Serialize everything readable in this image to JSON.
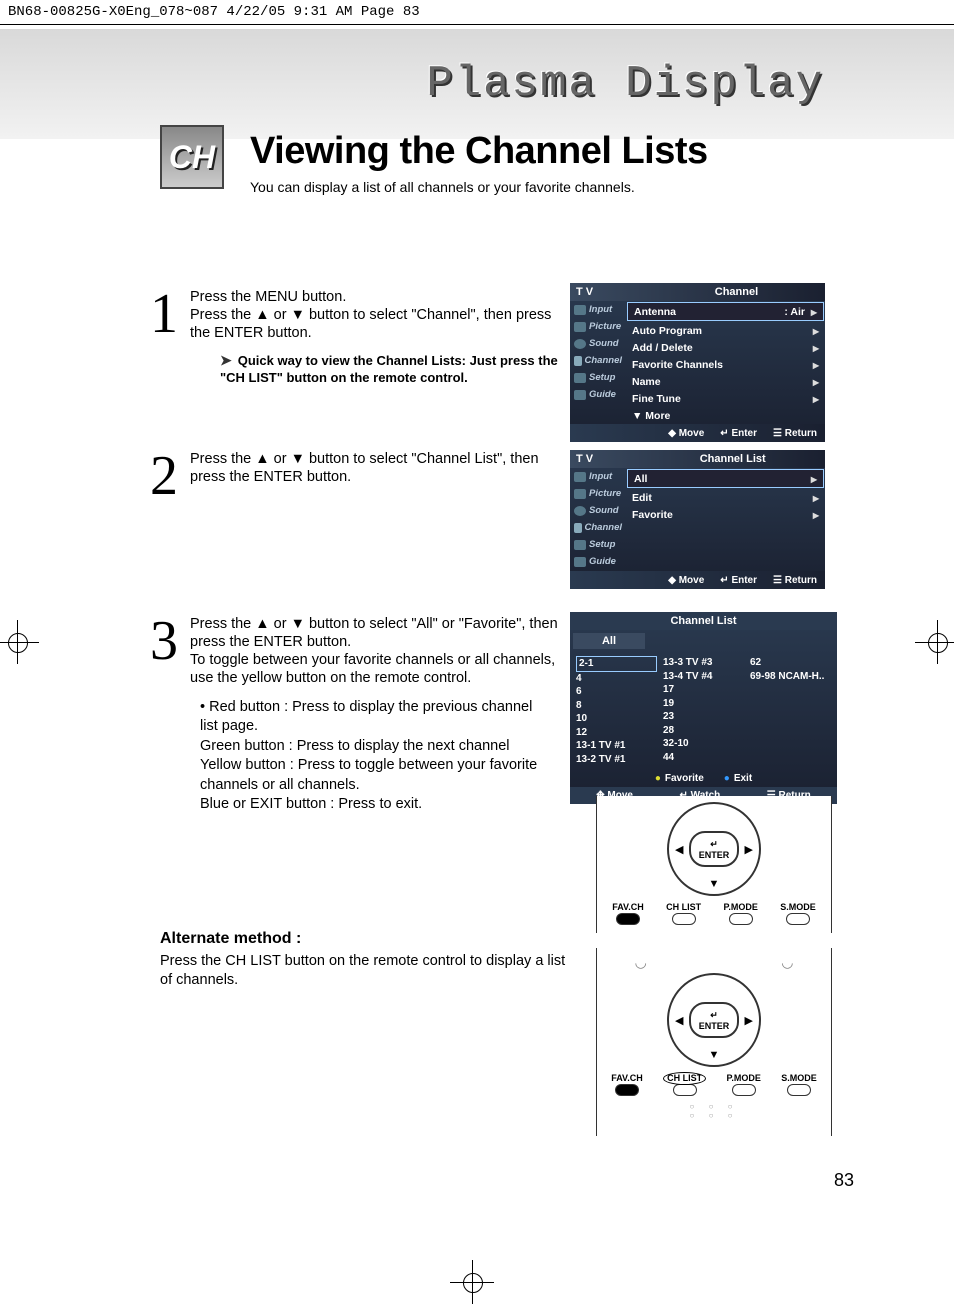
{
  "header_line": "BN68-00825G-X0Eng_078~087  4/22/05  9:31 AM  Page 83",
  "banner_text": "Plasma Display",
  "ch_badge": "CH",
  "title": "Viewing the Channel Lists",
  "subtitle": "You can display a list of all channels or your favorite channels.",
  "step1_num": "1",
  "step1_text": "Press the MENU button.\nPress the ▲ or ▼ button to select \"Channel\", then press the ENTER button.",
  "tip_text": "Quick way to view the Channel Lists: Just press the \"CH LIST\" button on the remote control.",
  "step2_num": "2",
  "step2_text": "Press the ▲ or ▼ button to select \"Channel List\", then press the ENTER button.",
  "step3_num": "3",
  "step3_text": "Press the ▲ or ▼ button to select \"All\" or \"Favorite\", then press the ENTER button.\nTo toggle between your favorite channels or all channels, use the yellow button on the remote control.",
  "step3_bullets": "• Red button : Press to display the previous channel\n                  list page.\n  Green button : Press to display the next channel\n  Yellow button : Press to toggle between your favorite\n                    channels or all channels.\n  Blue or EXIT button : Press to exit.",
  "alt_title": "Alternate method :",
  "alt_text": "Press the CH LIST button on the remote control to display a list of channels.",
  "page_number": "83",
  "osd_tv": "T V",
  "osd1_title": "Channel",
  "osd_side": {
    "input": "Input",
    "picture": "Picture",
    "sound": "Sound",
    "channel": "Channel",
    "setup": "Setup",
    "guide": "Guide"
  },
  "osd1_rows": {
    "antenna_l": "Antenna",
    "antenna_r": ": Air",
    "auto": "Auto Program",
    "add": "Add / Delete",
    "fav": "Favorite Channels",
    "name": "Name",
    "fine": "Fine Tune",
    "more": "▼ More"
  },
  "osd_foot": {
    "move": "Move",
    "enter": "Enter",
    "return": "Return"
  },
  "osd2_title": "Channel List",
  "osd2_rows": {
    "all": "All",
    "edit": "Edit",
    "favorite": "Favorite"
  },
  "cl_title": "Channel List",
  "cl_sub": "All",
  "cl_col1": {
    "a": "2-1",
    "b": "4",
    "c": "6",
    "d": "8",
    "e": "10",
    "f": "12",
    "g": "13-1 TV #1",
    "h": "13-2 TV #1"
  },
  "cl_col2": {
    "a": "13-3 TV #3",
    "b": "13-4 TV #4",
    "c": "17",
    "d": "19",
    "e": "23",
    "f": "28",
    "g": "32-10",
    "h": "44"
  },
  "cl_col3": {
    "a": "62",
    "b": "69-98 NCAM-H.."
  },
  "cl_footbtn": {
    "fav": "Favorite",
    "exit": "Exit"
  },
  "cl_footnav": {
    "move": "Move",
    "watch": "Watch",
    "return": "Return"
  },
  "remote": {
    "enter": "ENTER",
    "enter_icon": "↵",
    "fav": "FAV.CH",
    "chlist": "CH LIST",
    "pmode": "P.MODE",
    "smode": "S.MODE"
  },
  "nav_icons": {
    "updown": "◆",
    "enter_i": "↵",
    "menu": "☰",
    "dpad": "✥"
  }
}
